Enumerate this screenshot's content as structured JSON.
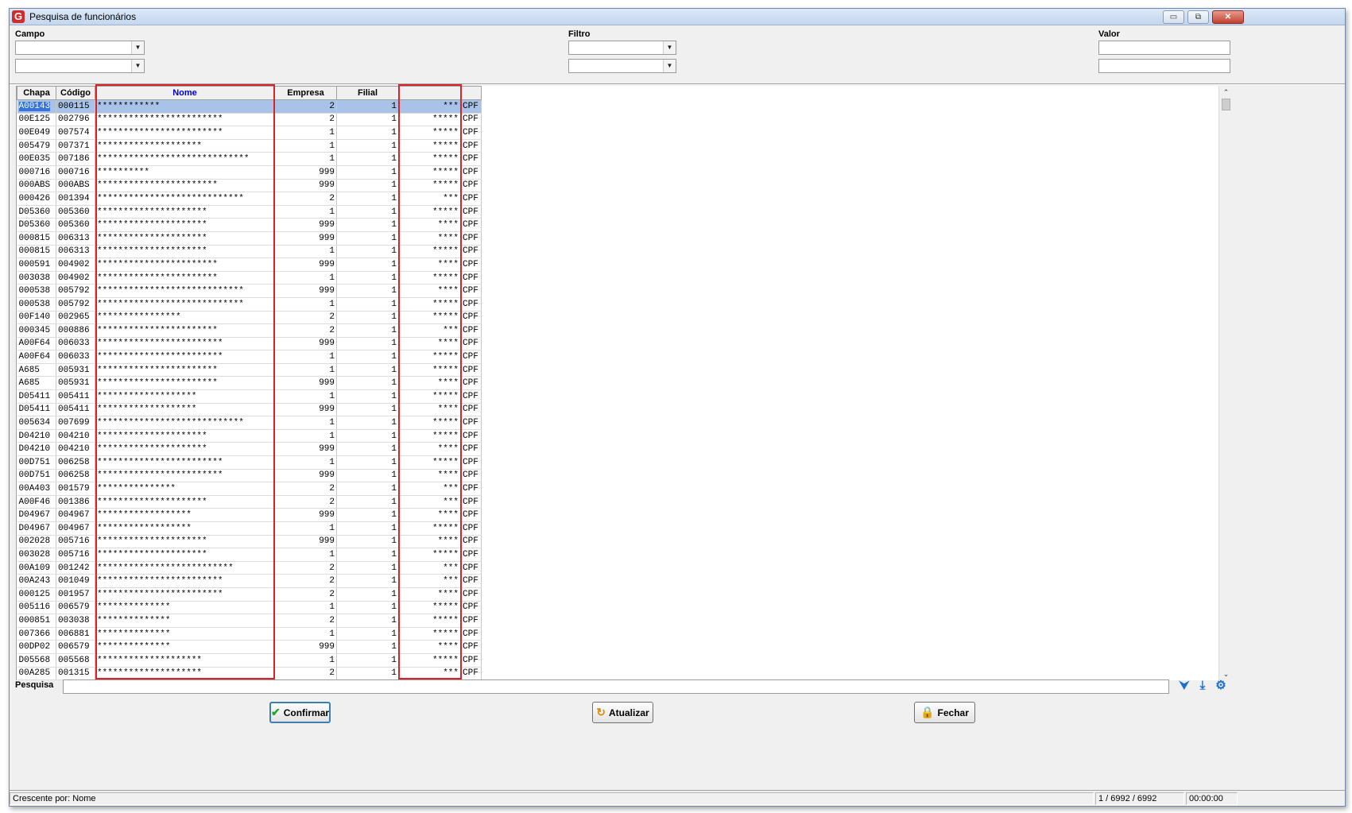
{
  "window": {
    "title": "Pesquisa de funcionários",
    "controls": [
      "▭",
      "⧉",
      "✕"
    ]
  },
  "filters": {
    "campo_label": "Campo",
    "filtro_label": "Filtro",
    "valor_label": "Valor",
    "campo1": "",
    "campo2": "",
    "filtro1": "",
    "filtro2": "",
    "valor1": "",
    "valor2": ""
  },
  "grid": {
    "columns": [
      "Chapa",
      "Código",
      "Nome",
      "Empresa",
      "Filial",
      "",
      ""
    ],
    "sorted_column": "Nome",
    "rows": [
      [
        "A00143",
        "000115",
        "************",
        "2",
        "1",
        "***",
        "CPF"
      ],
      [
        "00E125",
        "002796",
        "************************",
        "2",
        "1",
        "*****",
        "CPF"
      ],
      [
        "00E049",
        "007574",
        "************************",
        "1",
        "1",
        "*****",
        "CPF"
      ],
      [
        "005479",
        "007371",
        "********************",
        "1",
        "1",
        "*****",
        "CPF"
      ],
      [
        "00E035",
        "007186",
        "*****************************",
        "1",
        "1",
        "*****",
        "CPF"
      ],
      [
        "000716",
        "000716",
        "**********",
        "999",
        "1",
        "*****",
        "CPF"
      ],
      [
        "000ABS",
        "000ABS",
        "***********************",
        "999",
        "1",
        "*****",
        "CPF"
      ],
      [
        "000426",
        "001394",
        "****************************",
        "2",
        "1",
        "***",
        "CPF"
      ],
      [
        "D05360",
        "005360",
        "*********************",
        "1",
        "1",
        "*****",
        "CPF"
      ],
      [
        "D05360",
        "005360",
        "*********************",
        "999",
        "1",
        "****",
        "CPF"
      ],
      [
        "000815",
        "006313",
        "*********************",
        "999",
        "1",
        "****",
        "CPF"
      ],
      [
        "000815",
        "006313",
        "*********************",
        "1",
        "1",
        "*****",
        "CPF"
      ],
      [
        "000591",
        "004902",
        "***********************",
        "999",
        "1",
        "****",
        "CPF"
      ],
      [
        "003038",
        "004902",
        "***********************",
        "1",
        "1",
        "*****",
        "CPF"
      ],
      [
        "000538",
        "005792",
        "****************************",
        "999",
        "1",
        "****",
        "CPF"
      ],
      [
        "000538",
        "005792",
        "****************************",
        "1",
        "1",
        "*****",
        "CPF"
      ],
      [
        "00F140",
        "002965",
        "****************",
        "2",
        "1",
        "*****",
        "CPF"
      ],
      [
        "000345",
        "000886",
        "***********************",
        "2",
        "1",
        "***",
        "CPF"
      ],
      [
        "A00F64",
        "006033",
        "************************",
        "999",
        "1",
        "****",
        "CPF"
      ],
      [
        "A00F64",
        "006033",
        "************************",
        "1",
        "1",
        "*****",
        "CPF"
      ],
      [
        "A685",
        "005931",
        "***********************",
        "1",
        "1",
        "*****",
        "CPF"
      ],
      [
        "A685",
        "005931",
        "***********************",
        "999",
        "1",
        "****",
        "CPF"
      ],
      [
        "D05411",
        "005411",
        "*******************",
        "1",
        "1",
        "*****",
        "CPF"
      ],
      [
        "D05411",
        "005411",
        "*******************",
        "999",
        "1",
        "****",
        "CPF"
      ],
      [
        "005634",
        "007699",
        "****************************",
        "1",
        "1",
        "*****",
        "CPF"
      ],
      [
        "D04210",
        "004210",
        "*********************",
        "1",
        "1",
        "*****",
        "CPF"
      ],
      [
        "D04210",
        "004210",
        "*********************",
        "999",
        "1",
        "****",
        "CPF"
      ],
      [
        "00D751",
        "006258",
        "************************",
        "1",
        "1",
        "*****",
        "CPF"
      ],
      [
        "00D751",
        "006258",
        "************************",
        "999",
        "1",
        "****",
        "CPF"
      ],
      [
        "00A403",
        "001579",
        "***************",
        "2",
        "1",
        "***",
        "CPF"
      ],
      [
        "A00F46",
        "001386",
        "*********************",
        "2",
        "1",
        "***",
        "CPF"
      ],
      [
        "D04967",
        "004967",
        "******************",
        "999",
        "1",
        "****",
        "CPF"
      ],
      [
        "D04967",
        "004967",
        "******************",
        "1",
        "1",
        "*****",
        "CPF"
      ],
      [
        "002028",
        "005716",
        "*********************",
        "999",
        "1",
        "****",
        "CPF"
      ],
      [
        "003028",
        "005716",
        "*********************",
        "1",
        "1",
        "*****",
        "CPF"
      ],
      [
        "00A109",
        "001242",
        "**************************",
        "2",
        "1",
        "***",
        "CPF"
      ],
      [
        "00A243",
        "001049",
        "************************",
        "2",
        "1",
        "***",
        "CPF"
      ],
      [
        "000125",
        "001957",
        "************************",
        "2",
        "1",
        "****",
        "CPF"
      ],
      [
        "005116",
        "006579",
        "**************",
        "1",
        "1",
        "*****",
        "CPF"
      ],
      [
        "000851",
        "003038",
        "**************",
        "2",
        "1",
        "*****",
        "CPF"
      ],
      [
        "007366",
        "006881",
        "**************",
        "1",
        "1",
        "*****",
        "CPF"
      ],
      [
        "00DP02",
        "006579",
        "**************",
        "999",
        "1",
        "****",
        "CPF"
      ],
      [
        "D05568",
        "005568",
        "********************",
        "1",
        "1",
        "*****",
        "CPF"
      ],
      [
        "00A285",
        "001315",
        "********************",
        "2",
        "1",
        "***",
        "CPF"
      ]
    ]
  },
  "search": {
    "label": "Pesquisa",
    "value": ""
  },
  "icons": {
    "down": "⮟",
    "last": "⤓",
    "settings": "⚙"
  },
  "buttons": {
    "confirm": "Confirmar",
    "refresh": "Atualizar",
    "close": "Fechar"
  },
  "status": {
    "sort": "Crescente por: Nome",
    "records": "1 / 6992 / 6992",
    "time": "00:00:00"
  }
}
